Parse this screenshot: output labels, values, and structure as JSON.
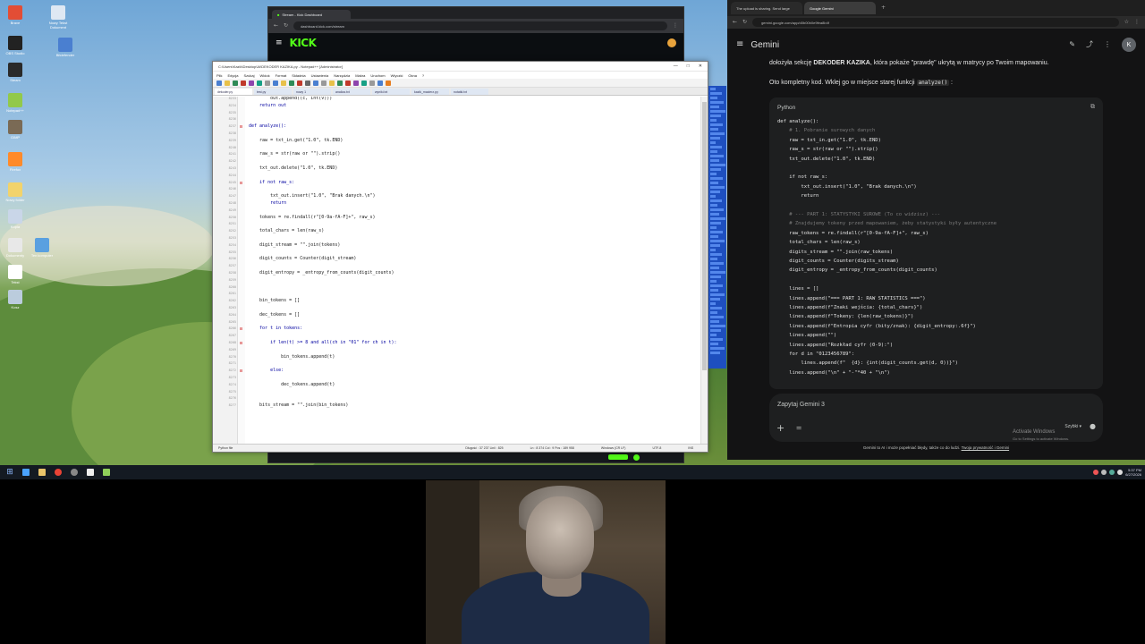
{
  "desktop": {
    "icons": [
      "Nowy Tekst Dokument",
      "Bitdefender",
      "Brave",
      "OBS Studio",
      "Steam",
      "Notepad++",
      "GIMP",
      "Firefox",
      "Nowy folder",
      "Kopia",
      "Dokumenty",
      "Ten komputer",
      "Tekst",
      "Kosz"
    ]
  },
  "kick_browser": {
    "tab_title": "Stream - Kick Dashboard",
    "url": "dashboard.kick.com/stream",
    "logo": "KICK"
  },
  "notepad": {
    "title": "C:\\Users\\Kazik\\Desktop\\AI\\DEKODER KAZIKA.py - Notepad++ [Administrator]",
    "menu": [
      "Plik",
      "Edycja",
      "Szukaj",
      "Widok",
      "Format",
      "Składnia",
      "Ustawienia",
      "Narzędzia",
      "Makra",
      "Uruchom",
      "Wtyczki",
      "Okna",
      "?"
    ],
    "tabs": [
      "dekoder.py",
      "test.py",
      "nowy 1",
      "analiza.txt",
      "wyniki.txt",
      "kazik_macierz.py",
      "notatki.txt"
    ],
    "status": {
      "lang": "Python file",
      "pos": "Długość : 37 237   Linii : 825",
      "ln": "Ln : 8 374   Col : 9   Pos : 189 958",
      "eol": "Windows (CR LF)",
      "enc": "UTF-8",
      "ins": "INS"
    },
    "lines": [
      {
        "n": "8233",
        "text": "        out.append((c, int(v)))",
        "marker": ""
      },
      {
        "n": "8234",
        "text": "    return out",
        "marker": ""
      },
      {
        "n": "8235",
        "text": "",
        "marker": ""
      },
      {
        "n": "8236",
        "text": "",
        "marker": ""
      },
      {
        "n": "8237",
        "text": "def analyze():",
        "marker": "⊟"
      },
      {
        "n": "8238",
        "text": "",
        "marker": ""
      },
      {
        "n": "8239",
        "text": "    raw = txt_in.get(\"1.0\", tk.END)",
        "marker": ""
      },
      {
        "n": "8240",
        "text": "",
        "marker": ""
      },
      {
        "n": "8241",
        "text": "    raw_s = str(raw or \"\").strip()",
        "marker": ""
      },
      {
        "n": "8242",
        "text": "",
        "marker": ""
      },
      {
        "n": "8243",
        "text": "    txt_out.delete(\"1.0\", tk.END)",
        "marker": ""
      },
      {
        "n": "8244",
        "text": "",
        "marker": ""
      },
      {
        "n": "8245",
        "text": "    if not raw_s:",
        "marker": "⊟"
      },
      {
        "n": "8246",
        "text": "",
        "marker": ""
      },
      {
        "n": "8247",
        "text": "        txt_out.insert(\"1.0\", \"Brak danych.\\n\")",
        "marker": ""
      },
      {
        "n": "8248",
        "text": "        return",
        "marker": ""
      },
      {
        "n": "8249",
        "text": "",
        "marker": ""
      },
      {
        "n": "8250",
        "text": "    tokens = re.findall(r\"[0-9a-fA-F]+\", raw_s)",
        "marker": ""
      },
      {
        "n": "8251",
        "text": "",
        "marker": ""
      },
      {
        "n": "8252",
        "text": "    total_chars = len(raw_s)",
        "marker": ""
      },
      {
        "n": "8253",
        "text": "",
        "marker": ""
      },
      {
        "n": "8254",
        "text": "    digit_stream = \"\".join(tokens)",
        "marker": ""
      },
      {
        "n": "8255",
        "text": "",
        "marker": ""
      },
      {
        "n": "8256",
        "text": "    digit_counts = Counter(digit_stream)",
        "marker": ""
      },
      {
        "n": "8257",
        "text": "",
        "marker": ""
      },
      {
        "n": "8258",
        "text": "    digit_entropy = _entropy_from_counts(digit_counts)",
        "marker": ""
      },
      {
        "n": "8259",
        "text": "",
        "marker": ""
      },
      {
        "n": "8260",
        "text": "",
        "marker": ""
      },
      {
        "n": "8261",
        "text": "",
        "marker": ""
      },
      {
        "n": "8262",
        "text": "    bin_tokens = []",
        "marker": ""
      },
      {
        "n": "8263",
        "text": "",
        "marker": ""
      },
      {
        "n": "8264",
        "text": "    dec_tokens = []",
        "marker": ""
      },
      {
        "n": "8265",
        "text": "",
        "marker": ""
      },
      {
        "n": "8266",
        "text": "    for t in tokens:",
        "marker": "⊟"
      },
      {
        "n": "8267",
        "text": "",
        "marker": ""
      },
      {
        "n": "8268",
        "text": "        if len(t) >= 8 and all(ch in \"01\" for ch in t):",
        "marker": "⊟"
      },
      {
        "n": "8269",
        "text": "",
        "marker": ""
      },
      {
        "n": "8270",
        "text": "            bin_tokens.append(t)",
        "marker": ""
      },
      {
        "n": "8271",
        "text": "",
        "marker": ""
      },
      {
        "n": "8272",
        "text": "        else:",
        "marker": "⊟"
      },
      {
        "n": "8273",
        "text": "",
        "marker": ""
      },
      {
        "n": "8274",
        "text": "            dec_tokens.append(t)",
        "marker": ""
      },
      {
        "n": "8275",
        "text": "",
        "marker": ""
      },
      {
        "n": "8276",
        "text": "",
        "marker": ""
      },
      {
        "n": "8277",
        "text": "    bits_stream = \"\".join(bin_tokens)",
        "marker": ""
      }
    ]
  },
  "gemini": {
    "tabs": [
      "The upload is sharing. Send large",
      "Google Gemini"
    ],
    "url": "gemini.google.com/app/d0b00b0e9fea8b4f",
    "title": "Gemini",
    "avatar": "K",
    "intro_prefix": "dołożyła sekcję ",
    "intro_bold": "DEKODER KAZIKA",
    "intro_suffix": ", która pokaże \"prawdę\" ukrytą w matrycy po Twoim mapowaniu.",
    "code_intro_prefix": "Oto kompletny kod. Wklej go w miejsce starej funkcji ",
    "code_intro_code": "analyze()",
    "code_intro_suffix": " :",
    "code_lang": "Python",
    "code": [
      {
        "t": "def analyze():",
        "c": "kw"
      },
      {
        "t": "    # 1. Pobranie surowych danych",
        "c": "com"
      },
      {
        "t": "    raw = txt_in.get(\"1.0\", tk.END)",
        "c": ""
      },
      {
        "t": "    raw_s = str(raw or \"\").strip()",
        "c": ""
      },
      {
        "t": "    txt_out.delete(\"1.0\", tk.END)",
        "c": ""
      },
      {
        "t": "",
        "c": ""
      },
      {
        "t": "    if not raw_s:",
        "c": "kw"
      },
      {
        "t": "        txt_out.insert(\"1.0\", \"Brak danych.\\n\")",
        "c": ""
      },
      {
        "t": "        return",
        "c": "kw"
      },
      {
        "t": "",
        "c": ""
      },
      {
        "t": "    # --- PART 1: STATYSTYKI SUROWE (To co widzisz) ---",
        "c": "com"
      },
      {
        "t": "    # Znajdujemy tokeny przed mapowaniem, żeby statystyki były autentyczne",
        "c": "com"
      },
      {
        "t": "    raw_tokens = re.findall(r\"[0-9a-fA-F]+\", raw_s)",
        "c": ""
      },
      {
        "t": "    total_chars = len(raw_s)",
        "c": ""
      },
      {
        "t": "    digits_stream = \"\".join(raw_tokens)",
        "c": ""
      },
      {
        "t": "    digit_counts = Counter(digits_stream)",
        "c": ""
      },
      {
        "t": "    digit_entropy = _entropy_from_counts(digit_counts)",
        "c": ""
      },
      {
        "t": "",
        "c": ""
      },
      {
        "t": "    lines = []",
        "c": ""
      },
      {
        "t": "    lines.append(\"=== PART 1: RAW STATISTICS ===\")",
        "c": ""
      },
      {
        "t": "    lines.append(f\"Znaki wejścia: {total_chars}\")",
        "c": ""
      },
      {
        "t": "    lines.append(f\"Tokeny: {len(raw_tokens)}\")",
        "c": ""
      },
      {
        "t": "    lines.append(f\"Entropia cyfr (bity/znak): {digit_entropy:.6f}\")",
        "c": ""
      },
      {
        "t": "    lines.append(\"\")",
        "c": ""
      },
      {
        "t": "    lines.append(\"Rozkład cyfr (0-9):\")",
        "c": ""
      },
      {
        "t": "    for d in \"0123456789\":",
        "c": "kw"
      },
      {
        "t": "        lines.append(f\"  {d}: {int(digit_counts.get(d, 0))}\")",
        "c": ""
      },
      {
        "t": "    lines.append(\"\\n\" + \"-\"*40 + \"\\n\")",
        "c": ""
      }
    ],
    "input_placeholder": "Zapytaj Gemini 3",
    "mode_label": "Szybki",
    "activate_title": "Activate Windows",
    "activate_sub": "Go to Settings to activate Windows.",
    "disclaimer": "Gemini to AI i może popełniać błędy, także co do ludzi.",
    "disclaimer_link": "Twoja prywatność i Gemini"
  },
  "taskbar": {
    "clock_time": "5:37 PM",
    "clock_date": "6/27/2026"
  }
}
